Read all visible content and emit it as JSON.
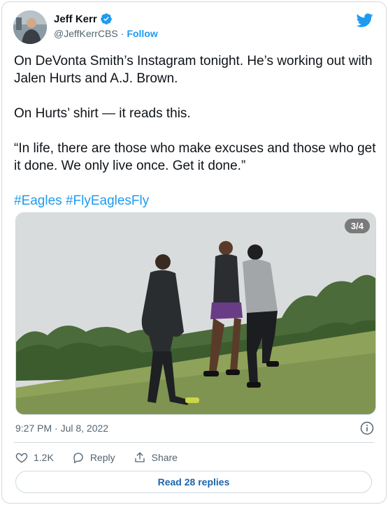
{
  "author": {
    "name": "Jeff Kerr",
    "handle": "@JeffKerrCBS",
    "separator": "·",
    "follow_label": "Follow",
    "verified": true
  },
  "tweet": {
    "paragraphs": [
      "On DeVonta Smith’s Instagram tonight. He’s working out with Jalen Hurts and A.J. Brown.",
      "On Hurts’ shirt — it reads this.",
      "“In life, there are those who make excuses and those who get it done. We only live once. Get it done.”"
    ],
    "hashtags": "#Eagles #FlyEaglesFly"
  },
  "media": {
    "pager": "3/4"
  },
  "meta": {
    "timestamp": "9:27 PM · Jul 8, 2022"
  },
  "actions": {
    "likes": "1.2K",
    "reply_label": "Reply",
    "share_label": "Share"
  },
  "read_replies_label": "Read 28 replies",
  "colors": {
    "accent": "#1d9bf0",
    "text": "#0f1419",
    "muted": "#536471",
    "border": "#cfd9de"
  }
}
